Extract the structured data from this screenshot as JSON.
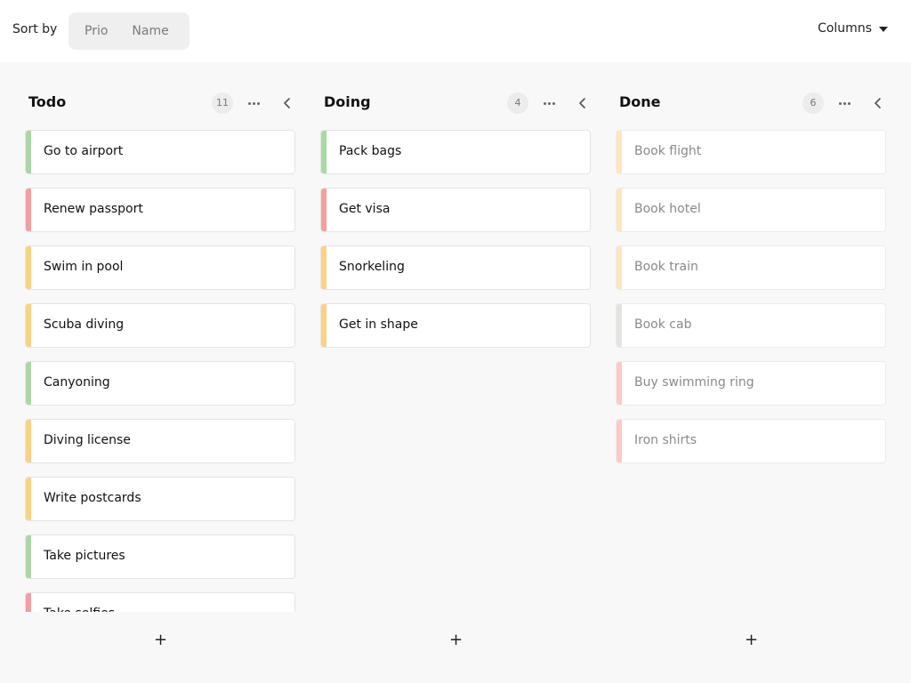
{
  "toolbar": {
    "sort_label": "Sort by",
    "sort_options": [
      "Prio",
      "Name"
    ],
    "columns_label": "Columns"
  },
  "priority_colors": {
    "green": "#a8d8a4",
    "red": "#f2a09d",
    "orange": "#fdd089",
    "grey": "#c9cdc9"
  },
  "columns": [
    {
      "title": "Todo",
      "count": "11",
      "done": false,
      "cards": [
        {
          "label": "Go to airport",
          "color": "#a8d8a4"
        },
        {
          "label": "Renew passport",
          "color": "#f2a09d"
        },
        {
          "label": "Swim in pool",
          "color": "#fdd089"
        },
        {
          "label": "Scuba diving",
          "color": "#fdd089"
        },
        {
          "label": "Canyoning",
          "color": "#a8d8a4"
        },
        {
          "label": "Diving license",
          "color": "#fdd089"
        },
        {
          "label": "Write postcards",
          "color": "#fdd089"
        },
        {
          "label": "Take pictures",
          "color": "#a8d8a4"
        },
        {
          "label": "Take selfies",
          "color": "#f2a09d"
        }
      ],
      "add_label": "+"
    },
    {
      "title": "Doing",
      "count": "4",
      "done": false,
      "cards": [
        {
          "label": "Pack bags",
          "color": "#a8d8a4"
        },
        {
          "label": "Get visa",
          "color": "#f2a09d"
        },
        {
          "label": "Snorkeling",
          "color": "#fdd089"
        },
        {
          "label": "Get in shape",
          "color": "#fdd089"
        }
      ],
      "add_label": "+"
    },
    {
      "title": "Done",
      "count": "6",
      "done": true,
      "cards": [
        {
          "label": "Book flight",
          "color": "#fdd089"
        },
        {
          "label": "Book hotel",
          "color": "#fdd089"
        },
        {
          "label": "Book train",
          "color": "#fdd089"
        },
        {
          "label": "Book cab",
          "color": "#c9cdc9"
        },
        {
          "label": "Buy swimming ring",
          "color": "#f2a09d"
        },
        {
          "label": "Iron shirts",
          "color": "#f2a09d"
        }
      ],
      "add_label": "+"
    }
  ]
}
